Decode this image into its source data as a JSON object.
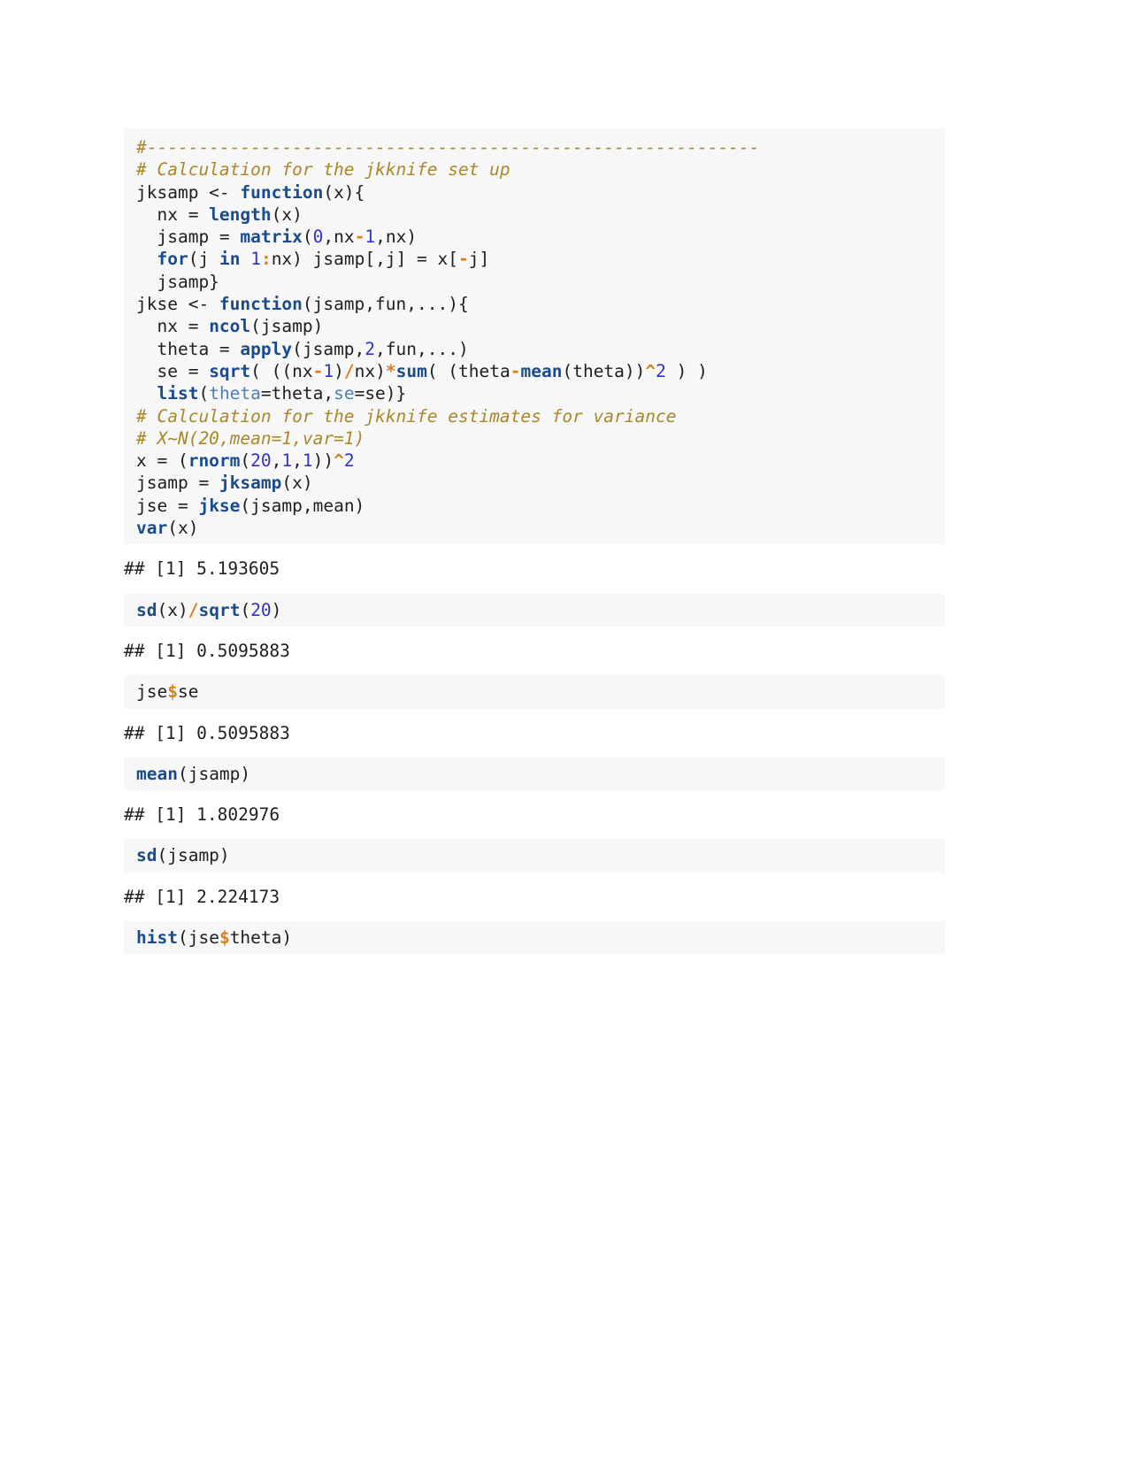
{
  "document": {
    "type": "r-markdown-knitted-output",
    "language": "R",
    "topic": "Jackknife calculation for variance estimates",
    "background_color": "#f7f7f7",
    "page_background": "#ffffff"
  },
  "colors": {
    "comment": "#a9872a",
    "keyword": "#1a4b8c",
    "function": "#1a4b8c",
    "number": "#3333c4",
    "operator": "#d4821e",
    "argument": "#4f7fb5",
    "plain": "#202020",
    "output": "#1a1a1a"
  },
  "blocks": [
    {
      "id": "code-block-1",
      "kind": "code",
      "lines": [
        [
          {
            "t": "#-----------------------------------------------------------",
            "c": "cm"
          }
        ],
        [
          {
            "t": "# Calculation for the jkknife set up",
            "c": "cm"
          }
        ],
        [
          {
            "t": "jksamp <- ",
            "c": "pl"
          },
          {
            "t": "function",
            "c": "kw"
          },
          {
            "t": "(x){",
            "c": "pl"
          }
        ],
        [
          {
            "t": "  nx = ",
            "c": "pl"
          },
          {
            "t": "length",
            "c": "kw"
          },
          {
            "t": "(x)",
            "c": "pl"
          }
        ],
        [
          {
            "t": "  jsamp = ",
            "c": "pl"
          },
          {
            "t": "matrix",
            "c": "kw"
          },
          {
            "t": "(",
            "c": "pl"
          },
          {
            "t": "0",
            "c": "num"
          },
          {
            "t": ",nx",
            "c": "pl"
          },
          {
            "t": "-",
            "c": "op"
          },
          {
            "t": "1",
            "c": "num"
          },
          {
            "t": ",nx)",
            "c": "pl"
          }
        ],
        [
          {
            "t": "  ",
            "c": "pl"
          },
          {
            "t": "for",
            "c": "kw"
          },
          {
            "t": "(j ",
            "c": "pl"
          },
          {
            "t": "in",
            "c": "kw"
          },
          {
            "t": " ",
            "c": "pl"
          },
          {
            "t": "1",
            "c": "num"
          },
          {
            "t": ":",
            "c": "op"
          },
          {
            "t": "nx) jsamp[,j] = x[",
            "c": "pl"
          },
          {
            "t": "-",
            "c": "op"
          },
          {
            "t": "j]",
            "c": "pl"
          }
        ],
        [
          {
            "t": "  jsamp}",
            "c": "pl"
          }
        ],
        [
          {
            "t": "jkse <- ",
            "c": "pl"
          },
          {
            "t": "function",
            "c": "kw"
          },
          {
            "t": "(jsamp,fun,...){",
            "c": "pl"
          }
        ],
        [
          {
            "t": "  nx = ",
            "c": "pl"
          },
          {
            "t": "ncol",
            "c": "kw"
          },
          {
            "t": "(jsamp)",
            "c": "pl"
          }
        ],
        [
          {
            "t": "  theta = ",
            "c": "pl"
          },
          {
            "t": "apply",
            "c": "kw"
          },
          {
            "t": "(jsamp,",
            "c": "pl"
          },
          {
            "t": "2",
            "c": "num"
          },
          {
            "t": ",fun,...)",
            "c": "pl"
          }
        ],
        [
          {
            "t": "  se = ",
            "c": "pl"
          },
          {
            "t": "sqrt",
            "c": "kw"
          },
          {
            "t": "( ((nx",
            "c": "pl"
          },
          {
            "t": "-",
            "c": "op"
          },
          {
            "t": "1",
            "c": "num"
          },
          {
            "t": ")",
            "c": "pl"
          },
          {
            "t": "/",
            "c": "op"
          },
          {
            "t": "nx)",
            "c": "pl"
          },
          {
            "t": "*",
            "c": "op"
          },
          {
            "t": "sum",
            "c": "kw"
          },
          {
            "t": "( (theta",
            "c": "pl"
          },
          {
            "t": "-",
            "c": "op"
          },
          {
            "t": "mean",
            "c": "kw"
          },
          {
            "t": "(theta))",
            "c": "pl"
          },
          {
            "t": "^",
            "c": "op"
          },
          {
            "t": "2",
            "c": "num"
          },
          {
            "t": " ) )",
            "c": "pl"
          }
        ],
        [
          {
            "t": "  ",
            "c": "pl"
          },
          {
            "t": "list",
            "c": "kw"
          },
          {
            "t": "(",
            "c": "pl"
          },
          {
            "t": "theta",
            "c": "arg"
          },
          {
            "t": "=theta,",
            "c": "pl"
          },
          {
            "t": "se",
            "c": "arg"
          },
          {
            "t": "=se)}",
            "c": "pl"
          }
        ],
        [
          {
            "t": "# Calculation for the jkknife estimates for variance",
            "c": "cm"
          }
        ],
        [
          {
            "t": "# X~N(20,mean=1,var=1)",
            "c": "cm"
          }
        ],
        [
          {
            "t": "x = (",
            "c": "pl"
          },
          {
            "t": "rnorm",
            "c": "kw"
          },
          {
            "t": "(",
            "c": "pl"
          },
          {
            "t": "20",
            "c": "num"
          },
          {
            "t": ",",
            "c": "pl"
          },
          {
            "t": "1",
            "c": "num"
          },
          {
            "t": ",",
            "c": "pl"
          },
          {
            "t": "1",
            "c": "num"
          },
          {
            "t": "))",
            "c": "pl"
          },
          {
            "t": "^",
            "c": "op"
          },
          {
            "t": "2",
            "c": "num"
          }
        ],
        [
          {
            "t": "jsamp = ",
            "c": "pl"
          },
          {
            "t": "jksamp",
            "c": "fn"
          },
          {
            "t": "(x)",
            "c": "pl"
          }
        ],
        [
          {
            "t": "jse = ",
            "c": "pl"
          },
          {
            "t": "jkse",
            "c": "fn"
          },
          {
            "t": "(jsamp,mean)",
            "c": "pl"
          }
        ],
        [
          {
            "t": "var",
            "c": "kw"
          },
          {
            "t": "(x)",
            "c": "pl"
          }
        ]
      ]
    },
    {
      "id": "output-block-1",
      "kind": "output",
      "lines": [
        [
          {
            "t": "## [1] 5.193605",
            "c": "pl"
          }
        ]
      ]
    },
    {
      "id": "code-block-2",
      "kind": "code",
      "lines": [
        [
          {
            "t": "sd",
            "c": "kw"
          },
          {
            "t": "(x)",
            "c": "pl"
          },
          {
            "t": "/",
            "c": "op"
          },
          {
            "t": "sqrt",
            "c": "kw"
          },
          {
            "t": "(",
            "c": "pl"
          },
          {
            "t": "20",
            "c": "num"
          },
          {
            "t": ")",
            "c": "pl"
          }
        ]
      ]
    },
    {
      "id": "output-block-2",
      "kind": "output",
      "lines": [
        [
          {
            "t": "## [1] 0.5095883",
            "c": "pl"
          }
        ]
      ]
    },
    {
      "id": "code-block-3",
      "kind": "code",
      "lines": [
        [
          {
            "t": "jse",
            "c": "pl"
          },
          {
            "t": "$",
            "c": "op"
          },
          {
            "t": "se",
            "c": "pl"
          }
        ]
      ]
    },
    {
      "id": "output-block-3",
      "kind": "output",
      "lines": [
        [
          {
            "t": "## [1] 0.5095883",
            "c": "pl"
          }
        ]
      ]
    },
    {
      "id": "code-block-4",
      "kind": "code",
      "lines": [
        [
          {
            "t": "mean",
            "c": "kw"
          },
          {
            "t": "(jsamp)",
            "c": "pl"
          }
        ]
      ]
    },
    {
      "id": "output-block-4",
      "kind": "output",
      "lines": [
        [
          {
            "t": "## [1] 1.802976",
            "c": "pl"
          }
        ]
      ]
    },
    {
      "id": "code-block-5",
      "kind": "code",
      "lines": [
        [
          {
            "t": "sd",
            "c": "kw"
          },
          {
            "t": "(jsamp)",
            "c": "pl"
          }
        ]
      ]
    },
    {
      "id": "output-block-5",
      "kind": "output",
      "lines": [
        [
          {
            "t": "## [1] 2.224173",
            "c": "pl"
          }
        ]
      ]
    },
    {
      "id": "code-block-6",
      "kind": "code",
      "lines": [
        [
          {
            "t": "hist",
            "c": "kw"
          },
          {
            "t": "(jse",
            "c": "pl"
          },
          {
            "t": "$",
            "c": "op"
          },
          {
            "t": "theta)",
            "c": "pl"
          }
        ]
      ]
    }
  ]
}
